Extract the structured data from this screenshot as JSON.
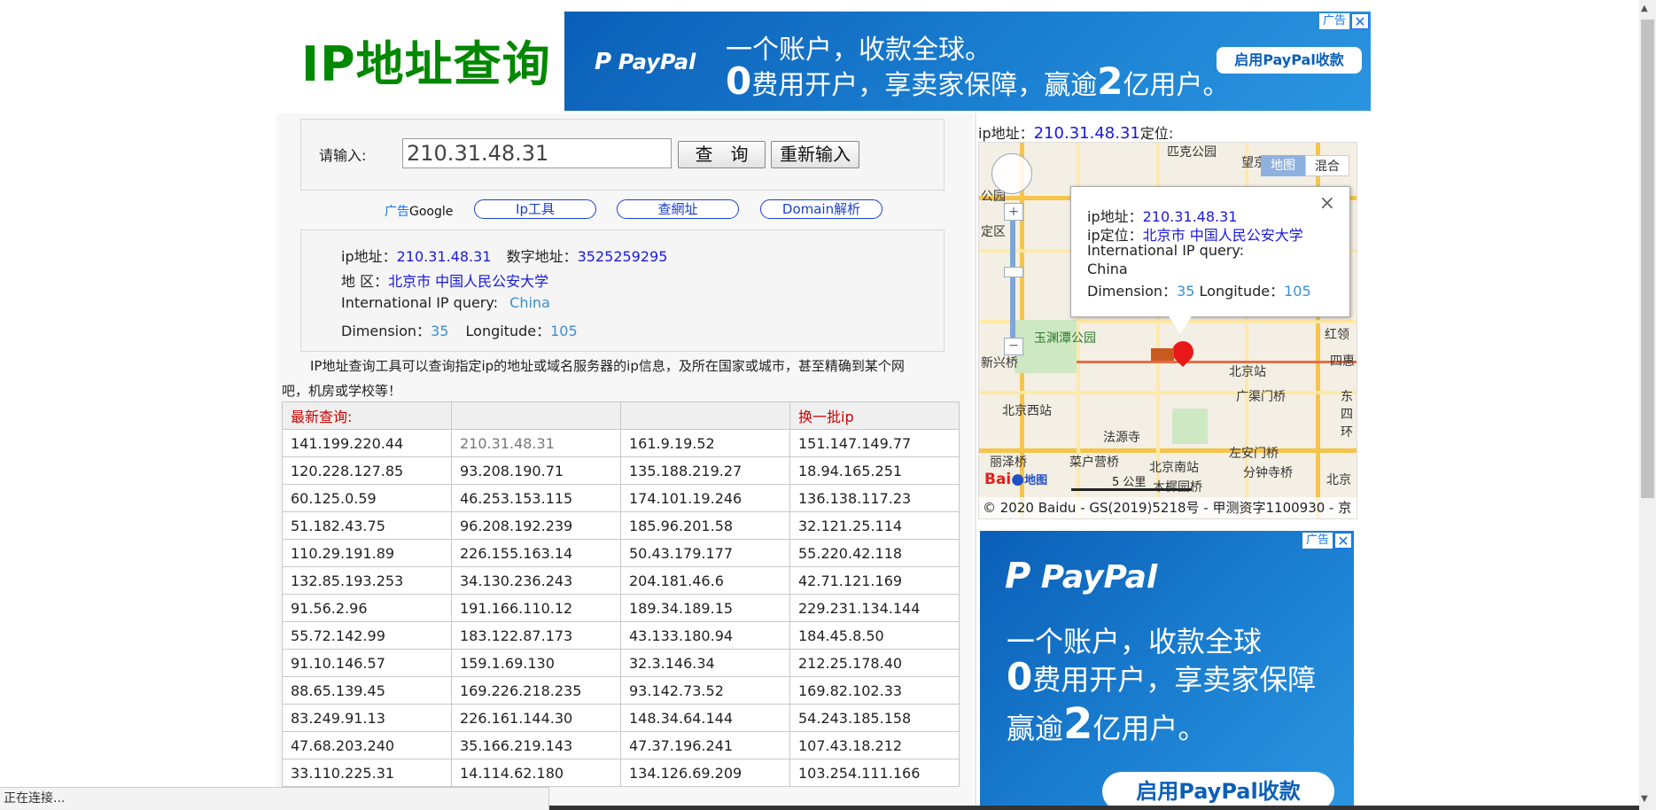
{
  "logo": "IP地址查询",
  "top_ad": {
    "tag": "广告",
    "close": "✕",
    "brand": "PayPal",
    "line1": "一个账户，收款全球。",
    "line2_a": "0",
    "line2_b": "费用开户，享卖家保障，赢逾",
    "line2_c": "2",
    "line2_d": "亿用户。",
    "button": "启用PayPal收款"
  },
  "search": {
    "label": "请输入:",
    "value": "210.31.48.31",
    "query_button": "查　询",
    "reset_button": "重新输入"
  },
  "links": {
    "ad_prefix": "广告",
    "ad_brand": "Google",
    "items": [
      "Ip工具",
      "查網址",
      "Domain解析"
    ]
  },
  "result": {
    "ip_label": "ip地址：",
    "ip_value": "210.31.48.31",
    "num_label": "数字地址：",
    "num_value": "3525259295",
    "region_label": "地 区：",
    "region_value": "北京市 中国人民公安大学",
    "intl_label": "International IP query:",
    "intl_value": "China",
    "dim_label": "Dimension：",
    "dim_value": "35",
    "lon_label": "Longitude：",
    "lon_value": "105"
  },
  "description_line1": "IP地址查询工具可以查询指定ip的地址或域名服务器的ip信息，及所在国家或城市，甚至精确到某个网",
  "description_line2": "吧，机房或学校等！",
  "table": {
    "header": [
      "最新查询:",
      "",
      "",
      "换一批ip"
    ],
    "rows": [
      [
        "141.199.220.44",
        "210.31.48.31",
        "161.9.19.52",
        "151.147.149.77"
      ],
      [
        "120.228.127.85",
        "93.208.190.71",
        "135.188.219.27",
        "18.94.165.251"
      ],
      [
        "60.125.0.59",
        "46.253.153.115",
        "174.101.19.246",
        "136.138.117.23"
      ],
      [
        "51.182.43.75",
        "96.208.192.239",
        "185.96.201.58",
        "32.121.25.114"
      ],
      [
        "110.29.191.89",
        "226.155.163.14",
        "50.43.179.177",
        "55.220.42.118"
      ],
      [
        "132.85.193.253",
        "34.130.236.243",
        "204.181.46.6",
        "42.71.121.169"
      ],
      [
        "91.56.2.96",
        "191.166.110.12",
        "189.34.189.15",
        "229.231.134.144"
      ],
      [
        "55.72.142.99",
        "183.122.87.173",
        "43.133.180.94",
        "184.45.8.50"
      ],
      [
        "91.10.146.57",
        "159.1.69.130",
        "32.3.146.34",
        "212.25.178.40"
      ],
      [
        "88.65.139.45",
        "169.226.218.235",
        "93.142.73.52",
        "169.82.102.33"
      ],
      [
        "83.249.91.13",
        "226.161.144.30",
        "148.34.64.144",
        "54.243.185.158"
      ],
      [
        "47.68.203.240",
        "35.166.219.143",
        "47.37.196.241",
        "107.43.18.212"
      ],
      [
        "33.110.225.31",
        "14.114.62.180",
        "134.126.69.209",
        "103.254.111.166"
      ]
    ]
  },
  "map_panel": {
    "caption_prefix": "ip地址：",
    "caption_ip": "210.31.48.31",
    "caption_suffix": "定位:",
    "tab_map": "地图",
    "tab_hybrid": "混合",
    "labels": [
      "匹克公园",
      "望京",
      "公园",
      "定区",
      "玉渊潭公园",
      "新兴桥",
      "北京站",
      "北京西站",
      "广渠门桥",
      "法源寺",
      "丽泽桥",
      "菜户营桥",
      "北京南站",
      "左安门桥",
      "分钟寺桥",
      "木樨园桥",
      "红领",
      "四惠",
      "东四环",
      "北京"
    ],
    "scale": "5 公里",
    "baidu_logo": "Bai",
    "baidu_logo2": "地图",
    "copyright": "© 2020 Baidu - GS(2019)5218号 - 甲测资字1100930 - 京",
    "popup": {
      "ip_label": "ip地址：",
      "ip_value": "210.31.48.31",
      "loc_label": "ip定位：",
      "loc_value": "北京市 中国人民公安大学",
      "intl_label": "International IP query:",
      "intl_value": "China",
      "dim_label": "Dimension：",
      "dim_value": "35",
      "lon_label": "Longitude：",
      "lon_value": "105",
      "close": "×"
    }
  },
  "side_ad": {
    "tag": "广告",
    "close": "✕",
    "brand": "PayPal",
    "line1": "一个账户，收款全球",
    "line2_a": "0",
    "line2_b": "费用开户，享卖家保障",
    "line3_a": "赢逾",
    "line3_b": "2",
    "line3_c": "亿用户。",
    "button": "启用PayPal收款"
  },
  "status_bar": "正在连接..."
}
